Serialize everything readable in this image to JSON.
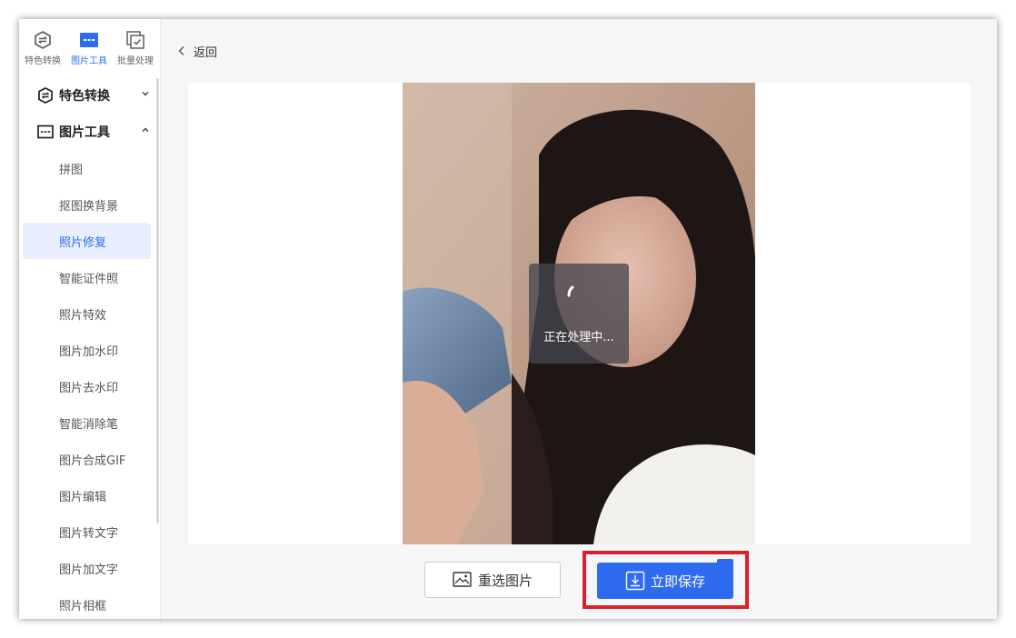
{
  "top_nav": [
    {
      "label": "特色转换",
      "icon": "swap-shield-icon"
    },
    {
      "label": "图片工具",
      "icon": "image-tool-icon"
    },
    {
      "label": "批量处理",
      "icon": "batch-icon"
    }
  ],
  "sidebar": {
    "group_special": {
      "label": "特色转换",
      "icon": "swap-shield-icon",
      "chevron": "chevron-down-icon"
    },
    "group_image_tools": {
      "label": "图片工具",
      "icon": "image-tool-icon",
      "chevron": "chevron-up-icon"
    },
    "items": [
      {
        "label": "拼图"
      },
      {
        "label": "抠图换背景"
      },
      {
        "label": "照片修复",
        "active": true
      },
      {
        "label": "智能证件照"
      },
      {
        "label": "照片特效"
      },
      {
        "label": "图片加水印"
      },
      {
        "label": "图片去水印"
      },
      {
        "label": "智能消除笔"
      },
      {
        "label": "图片合成GIF"
      },
      {
        "label": "图片编辑"
      },
      {
        "label": "图片转文字"
      },
      {
        "label": "图片加文字"
      },
      {
        "label": "照片相框"
      }
    ]
  },
  "main": {
    "back_label": "返回",
    "loading_text": "正在处理中...",
    "reselect_label": "重选图片",
    "save_label": "立即保存"
  },
  "colors": {
    "accent": "#2f6bf0",
    "highlight": "#e01e28",
    "active_bg": "#e9efff"
  }
}
